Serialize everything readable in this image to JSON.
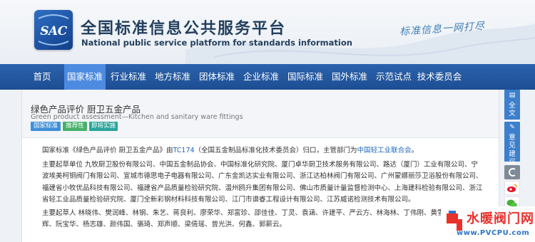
{
  "header": {
    "logo_text": "SAC",
    "title": "全国标准信息公共服务平台",
    "subtitle": "National public service platform  for standards information",
    "slogan": "标准信息一网打尽"
  },
  "nav": {
    "items": [
      {
        "label": "首页"
      },
      {
        "label": "国家标准",
        "active": true
      },
      {
        "label": "行业标准"
      },
      {
        "label": "地方标准"
      },
      {
        "label": "团体标准"
      },
      {
        "label": "企业标准"
      },
      {
        "label": "国际标准"
      },
      {
        "label": "国外标准"
      },
      {
        "label": "示范试点"
      },
      {
        "label": "技术委员会"
      }
    ]
  },
  "standard": {
    "title": "绿色产品评价 厨卫五金产品",
    "subtitle": "Green product assessment—Kitchen and sanitary ware fittings",
    "tags": [
      "国家标准",
      "推荐性",
      "即将实施"
    ]
  },
  "paragraphs": {
    "p1_before": "国家标准《绿色产品评价 厨卫五金产品》由",
    "p1_tc_link": "TC174",
    "p1_middle": "（全国五金制品标准化技术委员会）归口，主管部门为",
    "p1_dept_link": "中国轻工业联合会",
    "p1_after": "。",
    "p2": "主要起草单位 九牧厨卫股份有限公司、中国五金制品协会、中国标准化研究院、厦门卓华厨卫技术服务有限公司、路达（厦门）工业有限公司、宁波埃美柯铜阀门有限公司、宣城市德思电子电器有限公司、广东金凯达实业有限公司、浙江达柏林阀门有限公司、广州蒙娜丽莎卫浴股份有限公司、福建省小牧优品科技有限公司、福建省产品质量检验研究院、温州鸥升集团有限公司、佛山市质量计量监督检测中心、上海建科检验有限公司、浙江省轻工业品质量检验研究院、厦门全新彩钢材料科技有限公司、江门市谱睿工程设计有限公司、江苏威诺检测技术有限公司。",
    "p3": "主要起草人 林晓伟、樊润峰、林钢、朱艺、蒋良利、廖荣华、郑富珍、邵佳佳、丁灵、袁涵、许建平、严云方、林海林、丁伟刚、黄雪峰、孙剑辉、阮宝华、杨志雄、颜伟国、骆琦、郑声顺、梁倩瑶、曾光洪、何鑫、郭薪云。"
  },
  "sidebar": {
    "fulltext_label": "全文",
    "feedback_label": "意见建议"
  },
  "watermark": {
    "text": "水暖阀门网",
    "url": "www.PVCPU.com"
  },
  "colors": {
    "nav_bg": "#1d4e93",
    "nav_active": "#4d8be0",
    "link": "#1f66c1",
    "tag_national": "#3f8fd8",
    "tag_recommended": "#46b06a",
    "tag_upcoming": "#2aa59b"
  }
}
